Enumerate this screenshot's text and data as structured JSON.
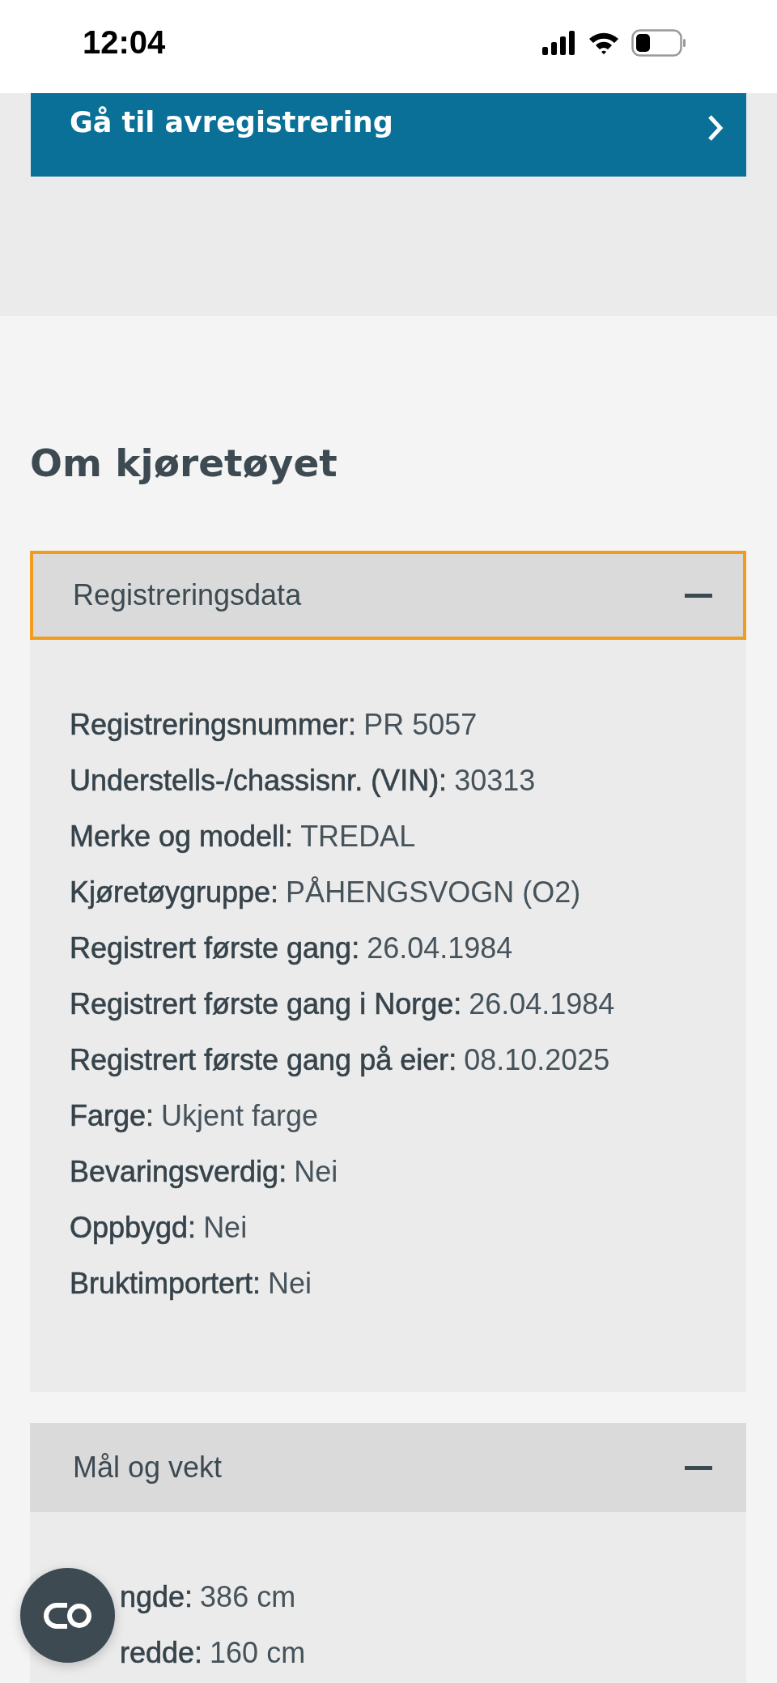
{
  "status_bar": {
    "time": "12:04"
  },
  "deregister_button": {
    "label": "Gå til avregistrering"
  },
  "heading": "Om kjøretøyet",
  "sections": [
    {
      "title": "Registreringsdata",
      "expanded": true,
      "focused": true,
      "rows": [
        {
          "label": "Registreringsnummer:",
          "value": "PR 5057"
        },
        {
          "label": "Understells-/chassisnr. (VIN):",
          "value": "30313"
        },
        {
          "label": "Merke og modell:",
          "value": "TREDAL"
        },
        {
          "label": "Kjøretøygruppe:",
          "value": "PÅHENGSVOGN (O2)"
        },
        {
          "label": "Registrert første gang:",
          "value": "26.04.1984"
        },
        {
          "label": "Registrert første gang i Norge:",
          "value": "26.04.1984"
        },
        {
          "label": "Registrert første gang på eier:",
          "value": "08.10.2025"
        },
        {
          "label": "Farge:",
          "value": "Ukjent farge"
        },
        {
          "label": "Bevaringsverdig:",
          "value": "Nei"
        },
        {
          "label": "Oppbygd:",
          "value": "Nei"
        },
        {
          "label": "Bruktimportert:",
          "value": "Nei"
        }
      ]
    },
    {
      "title": "Mål og vekt",
      "expanded": true,
      "focused": false,
      "rows": [
        {
          "label": "ngde:",
          "value": "386 cm",
          "covered": true
        },
        {
          "label": "redde:",
          "value": "160 cm",
          "covered": true
        }
      ]
    }
  ]
}
